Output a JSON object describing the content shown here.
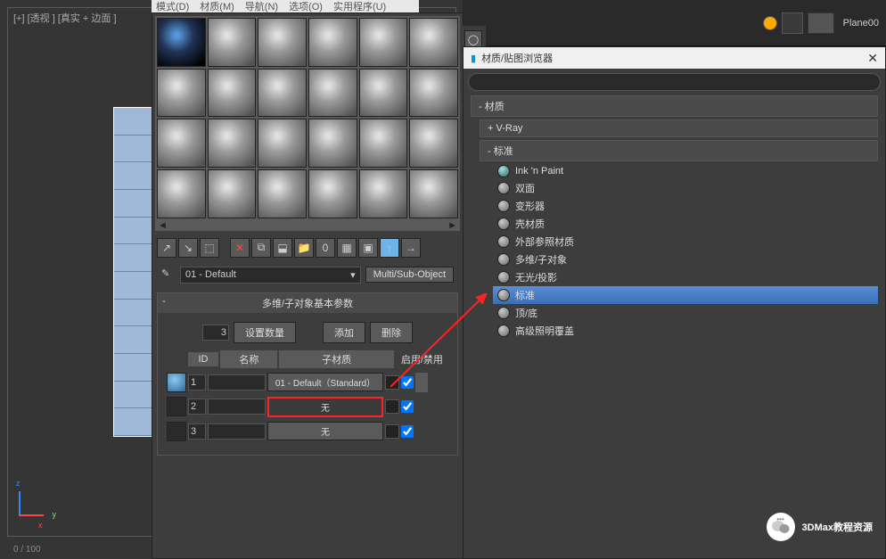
{
  "viewport": {
    "label": "[+] [透视 ] [真实 + 边面 ]",
    "status": "0 / 100"
  },
  "top_menu": [
    "模式(D)",
    "材质(M)",
    "导航(N)",
    "选项(O)",
    "实用程序(U)"
  ],
  "top_right": {
    "obj_name": "Plane00"
  },
  "mat_editor": {
    "name_dropdown": "01 - Default",
    "type_button": "Multi/Sub-Object",
    "rollout_title": "多维/子对象基本参数",
    "count": "3",
    "btn_set_count": "设置数量",
    "btn_add": "添加",
    "btn_delete": "删除",
    "col_id": "ID",
    "col_name": "名称",
    "col_submat": "子材质",
    "col_enable": "启用/禁用",
    "rows": [
      {
        "id": "1",
        "name": "",
        "mat": "01 - Default（Standard）",
        "empty": false,
        "highlighted": false
      },
      {
        "id": "2",
        "name": "",
        "mat": "无",
        "empty": true,
        "highlighted": true
      },
      {
        "id": "3",
        "name": "",
        "mat": "无",
        "empty": true,
        "highlighted": false
      }
    ]
  },
  "browser": {
    "title": "材质/贴图浏览器",
    "sections": [
      {
        "header": "- 材质",
        "items": []
      },
      {
        "header": "+ V-Ray",
        "items": []
      },
      {
        "header": "- 标准",
        "items": [
          {
            "label": "Ink 'n Paint",
            "cyan": true
          },
          {
            "label": "双面"
          },
          {
            "label": "变形器"
          },
          {
            "label": "壳材质"
          },
          {
            "label": "外部参照材质"
          },
          {
            "label": "多维/子对象"
          },
          {
            "label": "无光/投影"
          },
          {
            "label": "标准",
            "selected": true
          },
          {
            "label": "顶/底"
          },
          {
            "label": "高级照明覆盖"
          }
        ]
      }
    ]
  },
  "watermark": "3DMax教程资源"
}
